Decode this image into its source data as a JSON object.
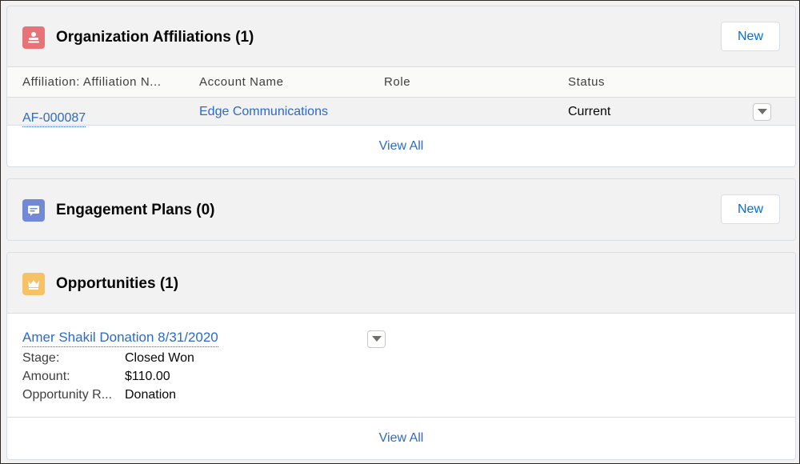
{
  "affiliations": {
    "title": "Organization Affiliations (1)",
    "icon": "affiliation-icon",
    "icon_color": "#e57378",
    "new_label": "New",
    "columns": [
      "Affiliation: Affiliation N...",
      "Account Name",
      "Role",
      "Status"
    ],
    "rows": [
      {
        "affiliation": "AF-000087",
        "account": "Edge Communications",
        "role": "",
        "status": "Current"
      }
    ],
    "view_all": "View All"
  },
  "engagement_plans": {
    "title": "Engagement Plans (0)",
    "icon": "engagement-plan-icon",
    "icon_color": "#7289d6",
    "new_label": "New"
  },
  "opportunities": {
    "title": "Opportunities (1)",
    "icon": "crown-icon",
    "icon_color": "#f7c165",
    "item": {
      "name": "Amer Shakil Donation 8/31/2020",
      "fields": [
        {
          "label": "Stage:",
          "value": "Closed Won"
        },
        {
          "label": "Amount:",
          "value": "$110.00"
        },
        {
          "label": "Opportunity R...",
          "value": "Donation"
        }
      ]
    },
    "view_all": "View All"
  }
}
